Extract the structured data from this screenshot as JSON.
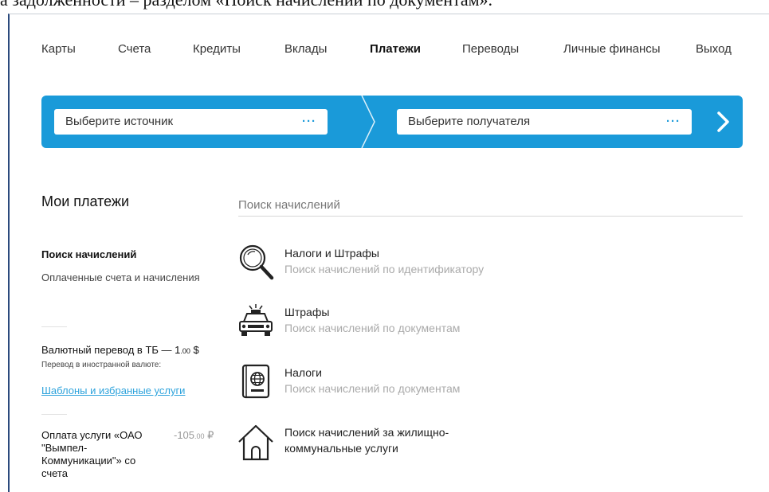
{
  "caption": "а задолженности – разделом «Поиск начислений по документам».",
  "nav": {
    "items": [
      {
        "label": "Карты"
      },
      {
        "label": "Счета"
      },
      {
        "label": "Кредиты"
      },
      {
        "label": "Вклады"
      },
      {
        "label": "Платежи",
        "active": true
      },
      {
        "label": "Переводы"
      },
      {
        "label": "Личные финансы"
      },
      {
        "label": "Выход"
      }
    ]
  },
  "transfer": {
    "source_placeholder": "Выберите источник",
    "recipient_placeholder": "Выберите получателя",
    "more_glyph": "···",
    "accent_color": "#1a9ad9"
  },
  "left": {
    "title": "Мои платежи",
    "search_link": "Поиск начислений",
    "paid_link": "Оплаченные счета и начисления",
    "transfer_title": "Валютный перевод в ТБ — 1",
    "transfer_cents": ".00",
    "transfer_currency": " $",
    "transfer_sub": "Перевод в иностранной валюте:",
    "templates_link": "Шаблоны и избранные услуги",
    "payment_title_lines": [
      "Оплата услуги «ОАО",
      "\"Вымпел-",
      "Коммуникации\"» со",
      "счета"
    ],
    "payment_amount": "-105",
    "payment_cents": ".00",
    "payment_currency": " ₽"
  },
  "search": {
    "label": "Поиск начислений"
  },
  "services": [
    {
      "title": "Налоги и Штрафы",
      "subtitle": "Поиск начислений по идентификатору",
      "icon": "magnifier-icon"
    },
    {
      "title": "Штрафы",
      "subtitle": "Поиск начислений по документам",
      "icon": "police-car-icon"
    },
    {
      "title": "Налоги",
      "subtitle": "Поиск начислений по документам",
      "icon": "passport-icon"
    },
    {
      "title": "Поиск начислений за жилищно-",
      "title2": "коммунальные услуги",
      "subtitle": "",
      "icon": "house-icon"
    }
  ]
}
